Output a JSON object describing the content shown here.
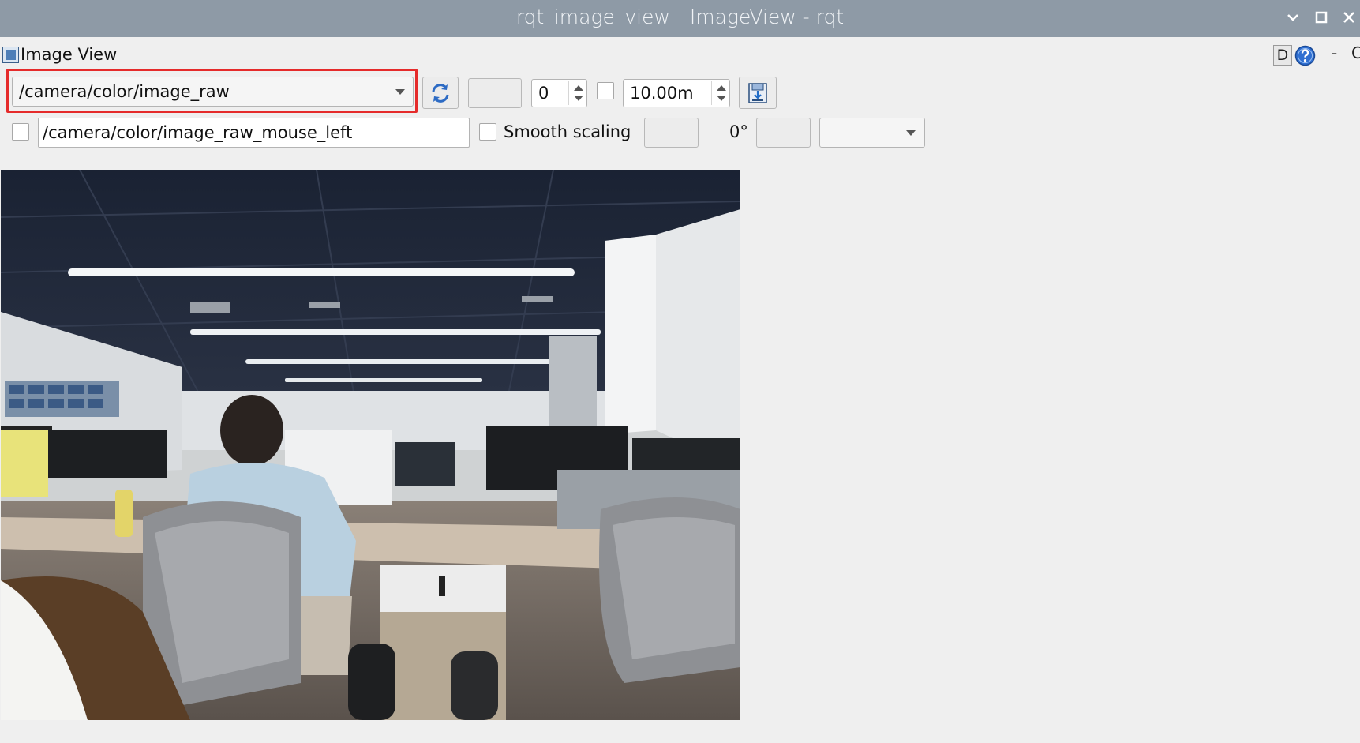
{
  "window": {
    "title": "rqt_image_view__ImageView - rqt"
  },
  "dock": {
    "title": "Image View",
    "d_button": "D",
    "dash": "-",
    "circle_fragment": "C"
  },
  "toolbar": {
    "topic": "/camera/color/image_raw",
    "spin_value": "0",
    "max_range": "10.00m",
    "mouse_topic": "/camera/color/image_raw_mouse_left",
    "smooth_scaling_label": "Smooth scaling",
    "rotation_label": "0°",
    "highlight_color": "#e52b2b"
  },
  "icons": {
    "refresh": "refresh-icon",
    "save": "save-icon",
    "help": "help-icon",
    "image_view": "image-view-icon"
  }
}
